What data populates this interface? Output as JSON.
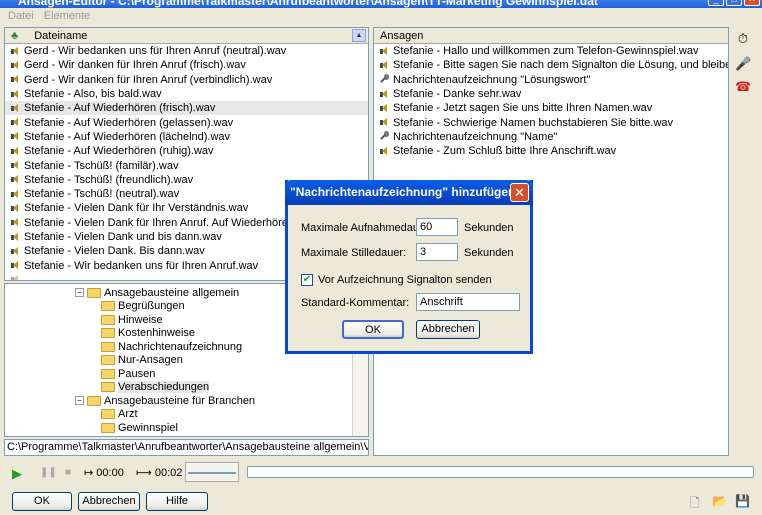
{
  "window": {
    "title": "Ansagen-Editor - C:\\Programme\\Talkmaster\\Anrufbeantworter\\Ansagen\\TT-Marketing Gewinnspiel.dat"
  },
  "menu": [
    "Datei",
    "Elemente"
  ],
  "files": {
    "header": "Dateiname",
    "items": [
      "Gerd - Wir bedanken uns für Ihren Anruf (neutral).wav",
      "Gerd - Wir danken für Ihren Anruf (frisch).wav",
      "Gerd - Wir danken für Ihren Anruf (verbindlich).wav",
      "Stefanie - Also, bis bald.wav",
      "Stefanie - Auf Wiederhören (frisch).wav",
      "Stefanie - Auf Wiederhören (gelassen).wav",
      "Stefanie - Auf Wiederhören (lächelnd).wav",
      "Stefanie - Auf Wiederhören (ruhig).wav",
      "Stefanie - Tschüß! (familär).wav",
      "Stefanie - Tschüß! (freundlich).wav",
      "Stefanie - Tschüß! (neutral).wav",
      "Stefanie - Vielen Dank für Ihr Verständnis.wav",
      "Stefanie - Vielen Dank für Ihren Anruf. Auf Wiederhören.wav",
      "Stefanie - Vielen Dank und bis dann.wav",
      "Stefanie - Vielen Dank. Bis dann.wav",
      "Stefanie - Wir bedanken uns für Ihren Anruf.wav"
    ]
  },
  "tree": {
    "items": [
      {
        "label": "Ansagebausteine allgemein",
        "level": 0,
        "expander": "⊟"
      },
      {
        "label": "Begrüßungen",
        "level": 1
      },
      {
        "label": "Hinweise",
        "level": 1
      },
      {
        "label": "Kostenhinweise",
        "level": 1
      },
      {
        "label": "Nachrichtenaufzeichnung",
        "level": 1
      },
      {
        "label": "Nur-Ansagen",
        "level": 1
      },
      {
        "label": "Pausen",
        "level": 1
      },
      {
        "label": "Verabschiedungen",
        "level": 1
      },
      {
        "label": "Ansagebausteine für Branchen",
        "level": 0,
        "expander": "⊟"
      },
      {
        "label": "Arzt",
        "level": 1
      },
      {
        "label": "Gewinnspiel",
        "level": 1
      }
    ]
  },
  "path": "C:\\Programme\\Talkmaster\\Anrufbeantworter\\Ansagebausteine allgemein\\Verabschiedung",
  "ansagen": {
    "header": "Ansagen",
    "items": [
      {
        "icon": "speaker",
        "label": "Stefanie - Hallo und willkommen zum Telefon-Gewinnspiel.wav"
      },
      {
        "icon": "speaker",
        "label": "Stefanie - Bitte sagen Sie nach dem Signalton die Lösung, und bleiben Sie da..."
      },
      {
        "icon": "mic",
        "label": "Nachrichtenaufzeichnung \"Lösungswort\""
      },
      {
        "icon": "speaker",
        "label": "Stefanie - Danke sehr.wav"
      },
      {
        "icon": "speaker",
        "label": "Stefanie - Jetzt sagen Sie uns bitte Ihren Namen.wav"
      },
      {
        "icon": "speaker",
        "label": "Stefanie - Schwierige Namen buchstabieren Sie bitte.wav"
      },
      {
        "icon": "mic",
        "label": "Nachrichtenaufzeichnung \"Name\""
      },
      {
        "icon": "speaker",
        "label": "Stefanie - Zum Schluß bitte Ihre Anschrift.wav"
      }
    ]
  },
  "player": {
    "time_start": "00:00",
    "time_end": "00:02"
  },
  "buttons": {
    "ok": "OK",
    "cancel": "Abbrechen",
    "help": "Hilfe"
  },
  "dialog": {
    "title": "\"Nachrichtenaufzeichnung\" hinzufügen",
    "max_duration_label": "Maximale Aufnahmedauer:",
    "max_duration_value": "60",
    "max_silence_label": "Maximale Stilledauer:",
    "max_silence_value": "3",
    "unit": "Sekunden",
    "beep_label": "Vor Aufzeichnung Signalton senden",
    "beep_checked": true,
    "comment_label": "Standard-Kommentar:",
    "comment_value": "Anschrift",
    "ok": "OK",
    "cancel": "Abbrechen"
  }
}
